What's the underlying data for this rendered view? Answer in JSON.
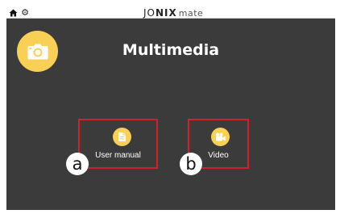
{
  "header": {
    "brand_main_pre": "JO",
    "brand_main_bold": "NIX",
    "brand_sub": "mate",
    "home_icon": "home-icon",
    "settings_icon": "gear-icon"
  },
  "screen": {
    "title": "Multimedia",
    "camera_icon": "camera-icon"
  },
  "tiles": [
    {
      "label": "User manual",
      "icon": "document-icon",
      "marker": "a"
    },
    {
      "label": "Video",
      "icon": "video-camera-icon",
      "marker": "b"
    }
  ],
  "colors": {
    "accent": "#f8d055",
    "background": "#3b3b3b",
    "highlight": "#d0202a"
  }
}
